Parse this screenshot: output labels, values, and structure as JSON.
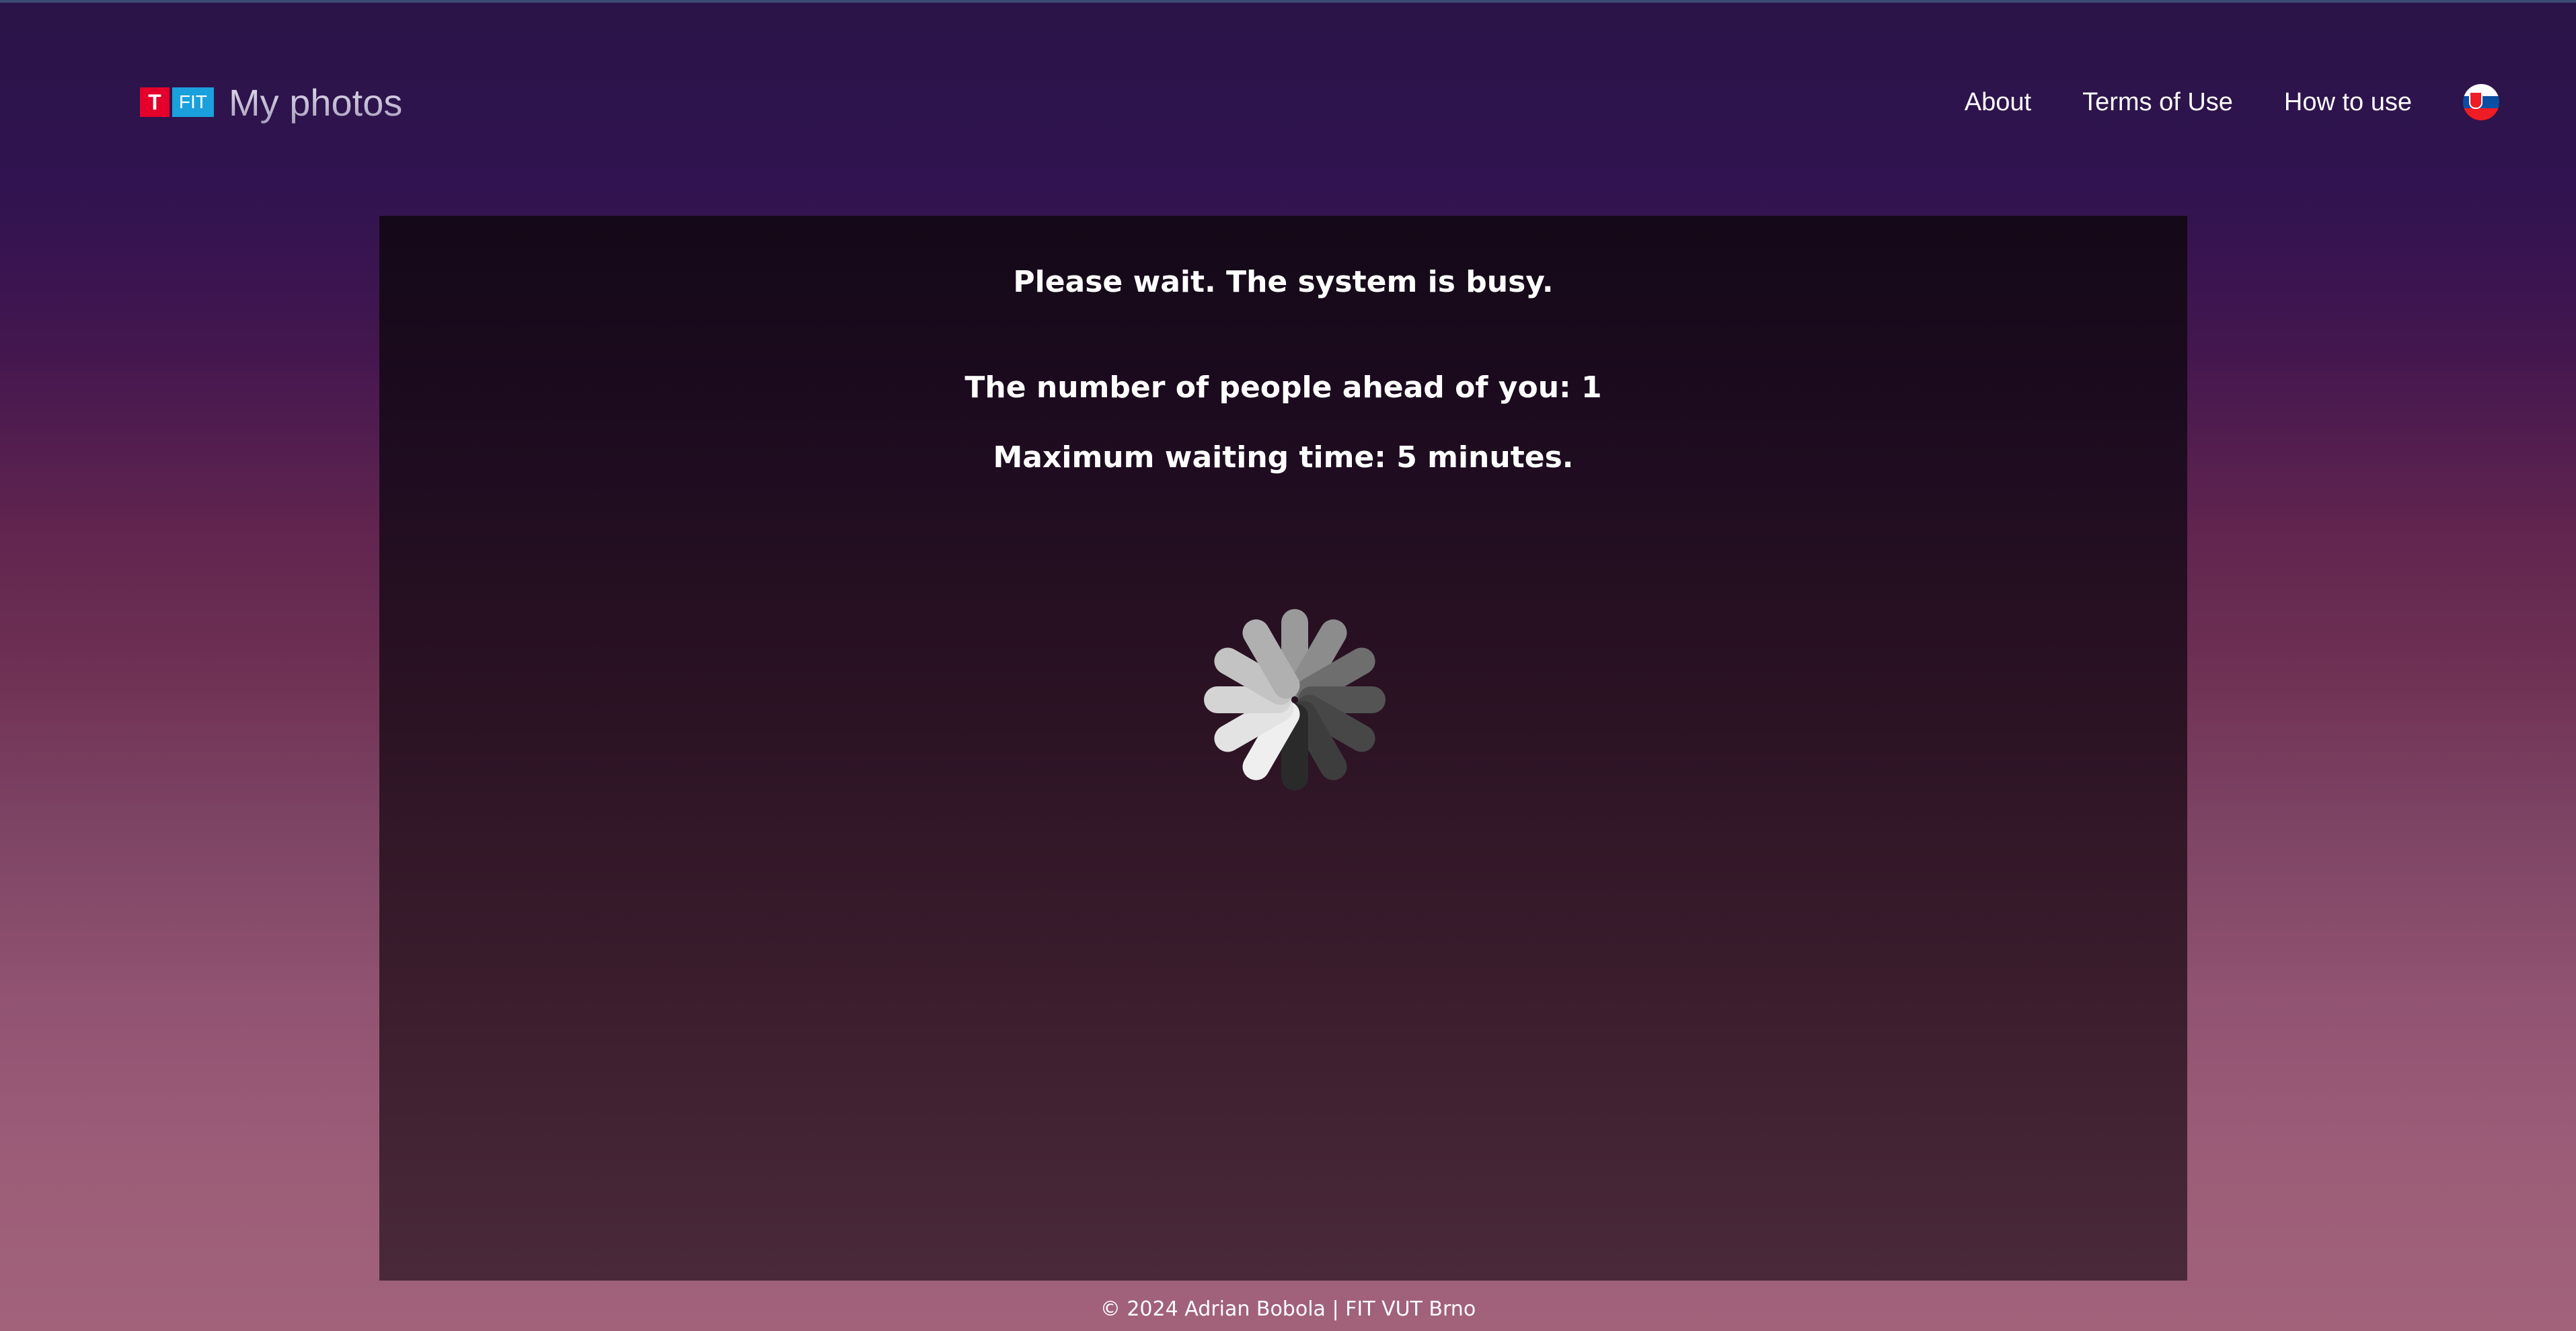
{
  "header": {
    "logo_t": "T",
    "logo_fit": "FIT",
    "title": "My photos",
    "nav": [
      "About",
      "Terms of Use",
      "How to use"
    ],
    "language_icon": "slovak-flag-icon"
  },
  "main": {
    "status_title": "Please wait. The system is busy.",
    "queue_text": "The number of people ahead of you: 1",
    "wait_text": "Maximum waiting time: 5 minutes.",
    "spinner_icon": "loading-spinner-icon"
  },
  "footer": {
    "text": "© 2024 Adrian Bobola | FIT VUT Brno"
  },
  "colors": {
    "logo_red": "#e4002b",
    "logo_blue": "#1aa0dc",
    "panel_dark": "#140918"
  }
}
